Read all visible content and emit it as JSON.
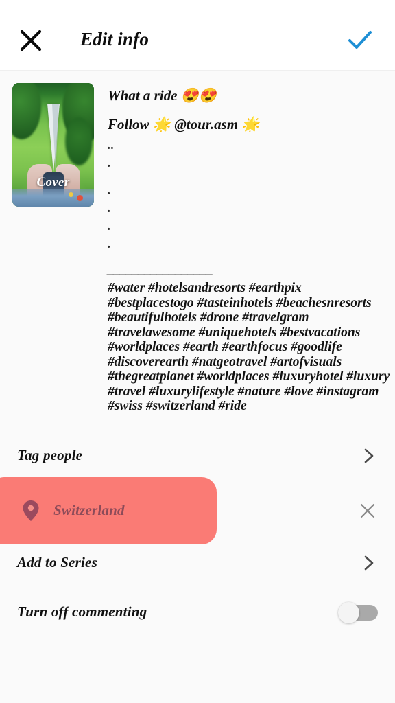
{
  "header": {
    "close_icon": "close-x-icon",
    "title": "Edit info",
    "confirm_icon": "check-icon",
    "confirm_color": "#1E8FD5"
  },
  "media": {
    "cover_label": "Cover",
    "alt": "grass-field-with-white-cone"
  },
  "caption": {
    "line1": "What a ride 😍😍",
    "line2": "Follow 🌟 @tour.asm 🌟",
    "dot_lines": [
      "..",
      ".",
      ".",
      ".",
      ".",
      "."
    ],
    "divider": "_________________",
    "hashtag_lines": [
      "#water #hotelsandresorts  #earthpix",
      "#bestplacestogo #tasteinhotels #beachesnresorts",
      "#beautifulhotels  #drone #travelgram",
      "#travelawesome #uniquehotels #bestvacations",
      "#worldplaces #earth #earthfocus #goodlife",
      "#discoverearth #natgeotravel #artofvisuals",
      "#thegreatplanet  #worldplaces #luxuryhotel #luxury",
      "#travel #luxurylifestyle #nature #love #instagram",
      "#swiss #switzerland #ride"
    ]
  },
  "options": {
    "tag_people": {
      "label": "Tag people",
      "chevron": "chevron-right-icon"
    },
    "location": {
      "value": "Switzerland",
      "pin_icon": "location-pin-icon",
      "clear_icon": "close-x-icon",
      "highlight_color": "#FA7B75"
    },
    "add_to_series": {
      "label": "Add to Series",
      "chevron": "chevron-right-icon"
    },
    "commenting": {
      "label": "Turn off commenting",
      "state": "off"
    }
  }
}
